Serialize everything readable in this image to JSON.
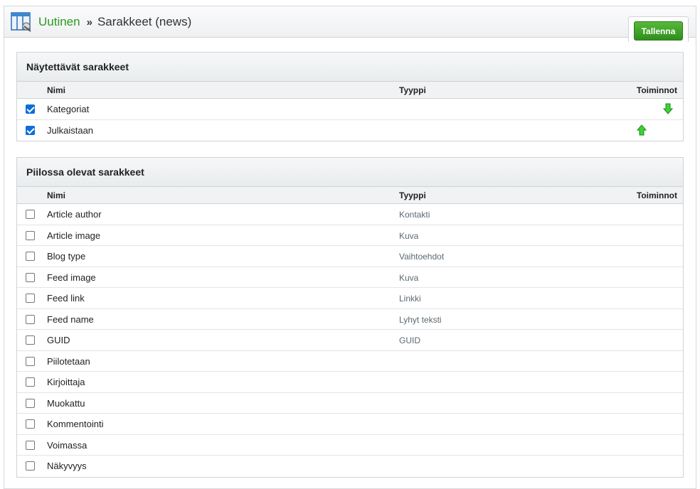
{
  "header": {
    "breadcrumb_link": "Uutinen",
    "breadcrumb_separator": "»",
    "breadcrumb_title": "Sarakkeet (news)",
    "save_label": "Tallenna",
    "accent_color": "#2a9a1e"
  },
  "visible_panel": {
    "title": "Näytettävät sarakkeet",
    "columns": {
      "name": "Nimi",
      "type": "Tyyppi",
      "actions": "Toiminnot"
    },
    "rows": [
      {
        "name": "Kategoriat",
        "type": "",
        "checked": true,
        "action_icon": "arrow-down-icon"
      },
      {
        "name": "Julkaistaan",
        "type": "",
        "checked": true,
        "action_icon": "arrow-up-icon"
      }
    ]
  },
  "hidden_panel": {
    "title": "Piilossa olevat sarakkeet",
    "columns": {
      "name": "Nimi",
      "type": "Tyyppi",
      "actions": "Toiminnot"
    },
    "rows": [
      {
        "name": "Article author",
        "type": "Kontakti",
        "checked": false
      },
      {
        "name": "Article image",
        "type": "Kuva",
        "checked": false
      },
      {
        "name": "Blog type",
        "type": "Vaihtoehdot",
        "checked": false
      },
      {
        "name": "Feed image",
        "type": "Kuva",
        "checked": false
      },
      {
        "name": "Feed link",
        "type": "Linkki",
        "checked": false
      },
      {
        "name": "Feed name",
        "type": "Lyhyt teksti",
        "checked": false
      },
      {
        "name": "GUID",
        "type": "GUID",
        "checked": false
      },
      {
        "name": "Piilotetaan",
        "type": "",
        "checked": false
      },
      {
        "name": "Kirjoittaja",
        "type": "",
        "checked": false
      },
      {
        "name": "Muokattu",
        "type": "",
        "checked": false
      },
      {
        "name": "Kommentointi",
        "type": "",
        "checked": false
      },
      {
        "name": "Voimassa",
        "type": "",
        "checked": false
      },
      {
        "name": "Näkyvyys",
        "type": "",
        "checked": false
      }
    ]
  }
}
